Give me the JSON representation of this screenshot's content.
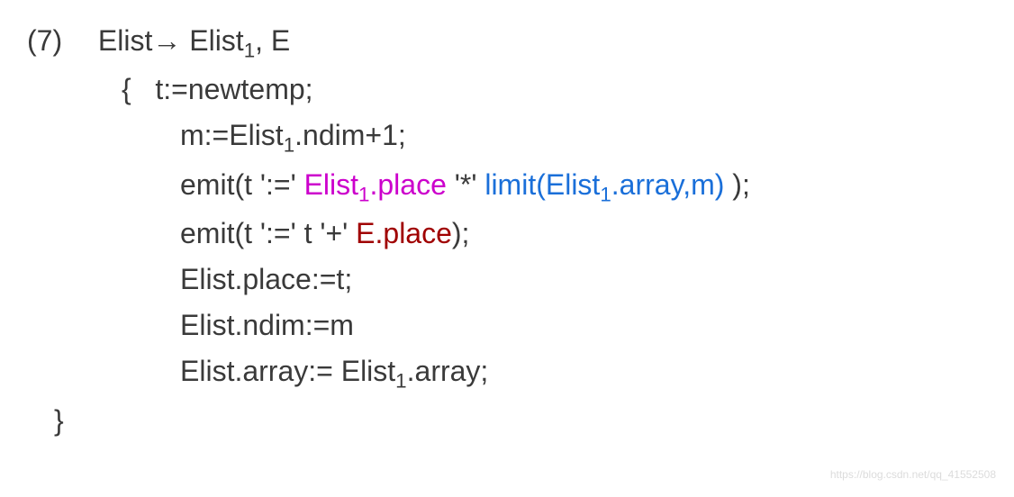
{
  "rule": {
    "number": "(7)",
    "production_lhs": "Elist",
    "arrow": "→",
    "production_rhs_a": "Elist",
    "production_rhs_sub": "1",
    "production_rhs_b": ", E"
  },
  "code": {
    "open_brace": "{",
    "line1": "t:=newtemp;",
    "line2_a": "m:=Elist",
    "line2_sub": "1",
    "line2_b": ".ndim+1;",
    "line3_a": "emit(t ':=' ",
    "line3_mag_a": "Elist",
    "line3_mag_sub": "1",
    "line3_mag_b": ".place",
    "line3_mid": " '*' ",
    "line3_blue_a": "limit(Elist",
    "line3_blue_sub": "1",
    "line3_blue_b": ".array,m)",
    "line3_end": " );",
    "line4_a": "emit(t ':='  t  '+' ",
    "line4_red": "E.place",
    "line4_end": ");",
    "line5": "Elist.place:=t;",
    "line6": "Elist.ndim:=m",
    "line7_a": "Elist.array:= Elist",
    "line7_sub": "1",
    "line7_b": ".array;",
    "close_brace": "}"
  },
  "watermark": "https://blog.csdn.net/qq_41552508"
}
